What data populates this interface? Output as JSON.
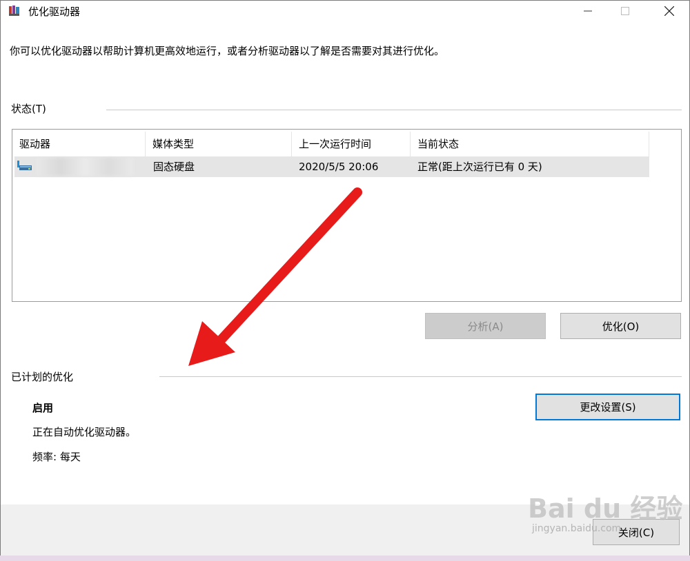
{
  "window": {
    "title": "优化驱动器",
    "description": "你可以优化驱动器以帮助计算机更高效地运行，或者分析驱动器以了解是否需要对其进行优化。"
  },
  "status_section": {
    "title": "状态(T)",
    "columns": [
      "驱动器",
      "媒体类型",
      "上一次运行时间",
      "当前状态"
    ],
    "rows": [
      {
        "drive": "",
        "media_type": "固态硬盘",
        "last_run": "2020/5/5 20:06",
        "current_status": "正常(距上次运行已有 0 天)"
      }
    ]
  },
  "actions": {
    "analyze_label": "分析(A)",
    "optimize_label": "优化(O)"
  },
  "scheduled_section": {
    "title": "已计划的优化",
    "status": "启用",
    "auto_text": "正在自动优化驱动器。",
    "frequency": "频率: 每天",
    "change_settings_label": "更改设置(S)"
  },
  "footer": {
    "close_label": "关闭(C)"
  },
  "watermark": {
    "brand": "Bai du 经验",
    "url": "jingyan.baidu.com"
  },
  "colors": {
    "focus_accent": "#0078d7",
    "arrow": "#e81b1b",
    "selected_row": "#e5e5e5"
  },
  "icons": {
    "app": "defrag-icon",
    "drive": "ssd-drive-icon",
    "annotation": "red-arrow-icon"
  }
}
